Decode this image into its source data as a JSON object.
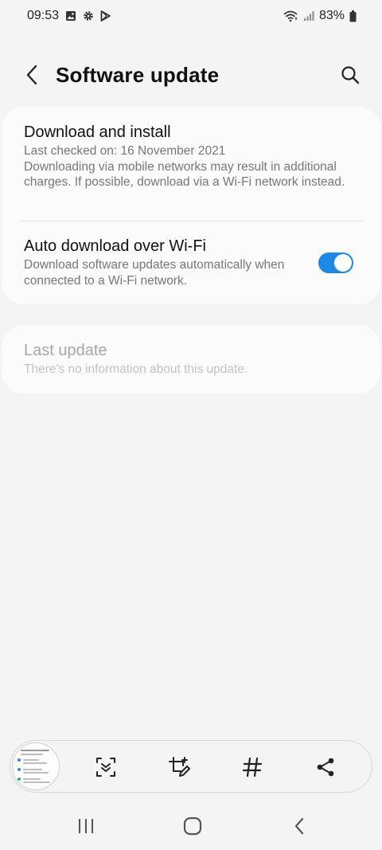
{
  "status_bar": {
    "time": "09:53",
    "battery": "83%",
    "left_icons": [
      "image-icon",
      "gear-icon",
      "play-store-icon"
    ],
    "right_icons": [
      "wifi-icon",
      "signal-icon",
      "battery-icon"
    ]
  },
  "header": {
    "title": "Software update",
    "back_icon": "chevron-left-icon",
    "search_icon": "search-icon"
  },
  "card_main": {
    "download": {
      "title": "Download and install",
      "last_checked": "Last checked on: 16 November 2021",
      "note": "Downloading via mobile networks may result in additional charges. If possible, download via a Wi-Fi network instead."
    },
    "auto_download": {
      "title": "Auto download over Wi-Fi",
      "description": "Download software updates automatically when connected to a Wi-Fi network.",
      "enabled": true
    }
  },
  "card_last_update": {
    "title": "Last update",
    "description": "There's no information about this update."
  },
  "screenshot_toolbar": {
    "tools": [
      "scroll-capture-icon",
      "crop-edit-icon",
      "hashtag-icon",
      "share-icon"
    ]
  },
  "nav_bar": {
    "buttons": [
      "recents-icon",
      "home-icon",
      "back-icon"
    ]
  },
  "colors": {
    "background": "#f4f4f4",
    "card": "#fbfbfb",
    "toggle_on": "#1e88e5"
  }
}
